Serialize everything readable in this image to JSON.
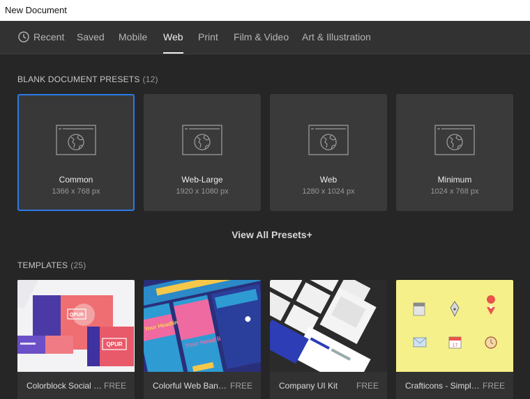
{
  "window": {
    "title": "New Document"
  },
  "tabs": [
    {
      "label": "Recent",
      "icon": "clock-icon"
    },
    {
      "label": "Saved"
    },
    {
      "label": "Mobile"
    },
    {
      "label": "Web",
      "active": true
    },
    {
      "label": "Print"
    },
    {
      "label": "Film & Video"
    },
    {
      "label": "Art & Illustration"
    }
  ],
  "presets_section": {
    "title": "BLANK DOCUMENT PRESETS",
    "count": "(12)"
  },
  "presets": [
    {
      "name": "Common",
      "size": "1366 x 768 px",
      "selected": true,
      "icon": "web-globe-icon"
    },
    {
      "name": "Web-Large",
      "size": "1920 x 1080 px",
      "icon": "web-globe-icon"
    },
    {
      "name": "Web",
      "size": "1280 x 1024 px",
      "icon": "web-globe-icon"
    },
    {
      "name": "Minimum",
      "size": "1024 x 768 px",
      "icon": "web-globe-icon"
    }
  ],
  "view_all": "View All Presets+",
  "templates_section": {
    "title": "TEMPLATES",
    "count": "(25)"
  },
  "templates": [
    {
      "name": "Colorblock Social Me...",
      "badge": "FREE",
      "thumb_text": [
        "QPUR",
        "QPUR"
      ]
    },
    {
      "name": "Colorful Web Banner...",
      "badge": "FREE",
      "thumb_text": [
        "Your Headline Here!",
        "Your Head line Here!"
      ]
    },
    {
      "name": "Company UI Kit",
      "badge": "FREE"
    },
    {
      "name": "Crafticons - Simple Set",
      "badge": "FREE",
      "thumb_text": [
        "17"
      ]
    }
  ],
  "colors": {
    "accent": "#2d7be5",
    "background": "#262626",
    "panel": "#323232",
    "card": "#3a3a3a"
  }
}
